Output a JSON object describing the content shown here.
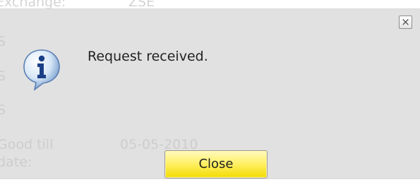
{
  "background_form": {
    "exchange_label": "Exchange:",
    "exchange_value": "ZSE",
    "row2_label": "S",
    "row3_label": "S",
    "row4_label": "S",
    "good_till_label_line1": "Good till",
    "good_till_label_line2": "date:",
    "good_till_value": "05-05-2010"
  },
  "dialog": {
    "icon": "info-icon",
    "message": "Request received.",
    "close_x_label": "×",
    "close_button_label": "Close"
  },
  "colors": {
    "button_yellow": "#fff16a",
    "overlay_gray": "#dedede"
  }
}
